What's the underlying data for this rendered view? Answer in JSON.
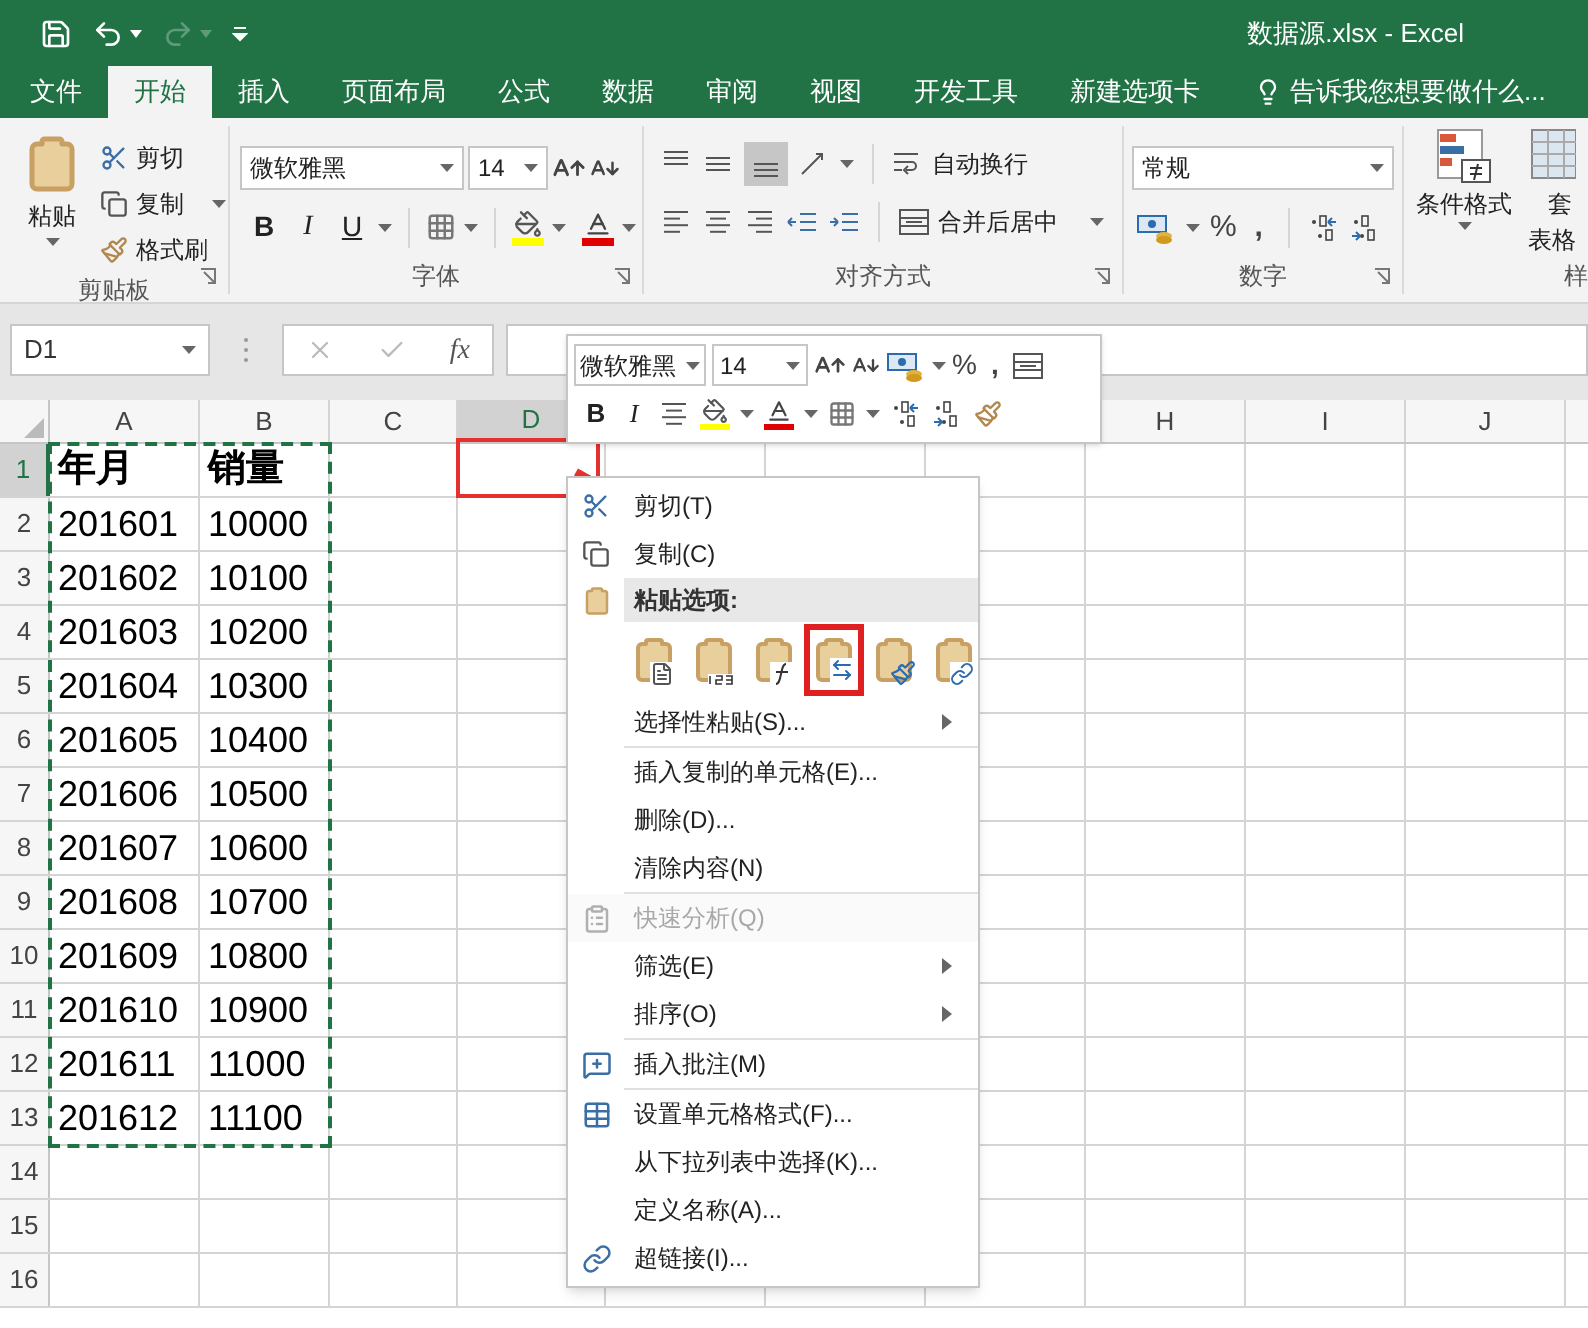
{
  "title_bar": {
    "title": "数据源.xlsx - Excel"
  },
  "ribbon_tabs": [
    {
      "label": "文件",
      "selected": false
    },
    {
      "label": "开始",
      "selected": true
    },
    {
      "label": "插入",
      "selected": false
    },
    {
      "label": "页面布局",
      "selected": false
    },
    {
      "label": "公式",
      "selected": false
    },
    {
      "label": "数据",
      "selected": false
    },
    {
      "label": "审阅",
      "selected": false
    },
    {
      "label": "视图",
      "selected": false
    },
    {
      "label": "开发工具",
      "selected": false
    },
    {
      "label": "新建选项卡",
      "selected": false
    }
  ],
  "tell_me": "告诉我您想要做什么...",
  "ribbon": {
    "clipboard": {
      "paste": "粘贴",
      "cut": "剪切",
      "copy": "复制",
      "format_painter": "格式刷",
      "label": "剪贴板"
    },
    "font": {
      "font_name": "微软雅黑",
      "font_size": "14",
      "bold": "B",
      "italic": "I",
      "underline": "U",
      "label": "字体"
    },
    "alignment": {
      "wrap_text": "自动换行",
      "merge_center": "合并后居中",
      "label": "对齐方式"
    },
    "number": {
      "format": "常规",
      "percent": "%",
      "comma": ",",
      "label": "数字"
    },
    "styles": {
      "conditional_formatting": "条件格式",
      "format_as_table_line1": "套",
      "format_as_table_line2": "表格",
      "label": "样"
    }
  },
  "formula_bar": {
    "name_box": "D1",
    "fx": "fx"
  },
  "sheet": {
    "marquee": true,
    "columns_left": [
      {
        "label": "A",
        "selected": false
      },
      {
        "label": "B",
        "selected": false
      },
      {
        "label": "C",
        "selected": false
      },
      {
        "label": "D",
        "selected": true
      }
    ],
    "columns_right": [
      {
        "label": "H",
        "selected": false
      },
      {
        "label": "I",
        "selected": false
      },
      {
        "label": "J",
        "selected": false
      }
    ],
    "rows": [
      {
        "label": "1",
        "selected": true,
        "kind": "header",
        "cells": [
          "年月",
          "销量"
        ]
      },
      {
        "label": "2",
        "selected": false,
        "kind": "data",
        "cells": [
          "201601",
          "10000"
        ]
      },
      {
        "label": "3",
        "selected": false,
        "kind": "data",
        "cells": [
          "201602",
          "10100"
        ]
      },
      {
        "label": "4",
        "selected": false,
        "kind": "data",
        "cells": [
          "201603",
          "10200"
        ]
      },
      {
        "label": "5",
        "selected": false,
        "kind": "data",
        "cells": [
          "201604",
          "10300"
        ]
      },
      {
        "label": "6",
        "selected": false,
        "kind": "data",
        "cells": [
          "201605",
          "10400"
        ]
      },
      {
        "label": "7",
        "selected": false,
        "kind": "data",
        "cells": [
          "201606",
          "10500"
        ]
      },
      {
        "label": "8",
        "selected": false,
        "kind": "data",
        "cells": [
          "201607",
          "10600"
        ]
      },
      {
        "label": "9",
        "selected": false,
        "kind": "data",
        "cells": [
          "201608",
          "10700"
        ]
      },
      {
        "label": "10",
        "selected": false,
        "kind": "data",
        "cells": [
          "201609",
          "10800"
        ]
      },
      {
        "label": "11",
        "selected": false,
        "kind": "data",
        "cells": [
          "201610",
          "10900"
        ]
      },
      {
        "label": "12",
        "selected": false,
        "kind": "data",
        "cells": [
          "201611",
          "11000"
        ]
      },
      {
        "label": "13",
        "selected": false,
        "kind": "data",
        "cells": [
          "201612",
          "11100"
        ]
      },
      {
        "label": "14",
        "selected": false,
        "kind": "empty"
      },
      {
        "label": "15",
        "selected": false,
        "kind": "empty"
      },
      {
        "label": "16",
        "selected": false,
        "kind": "empty"
      }
    ]
  },
  "mini_toolbar": {
    "font_name": "微软雅黑",
    "font_size": "14",
    "percent": "%",
    "comma": ",",
    "bold": "B",
    "italic": "I"
  },
  "context_menu": {
    "sections": [
      [
        {
          "kind": "command",
          "label": "剪切(T)",
          "disabled": false,
          "submenu": false
        },
        {
          "kind": "command",
          "label": "复制(C)",
          "disabled": false,
          "submenu": false
        },
        {
          "kind": "header",
          "label": "粘贴选项:"
        },
        {
          "kind": "paste_options",
          "options": [
            {
              "kind": "paste",
              "highlighted": false
            },
            {
              "kind": "values",
              "highlighted": false
            },
            {
              "kind": "formulas",
              "highlighted": false
            },
            {
              "kind": "transpose",
              "highlighted": true
            },
            {
              "kind": "formatting",
              "highlighted": false
            },
            {
              "kind": "link",
              "highlighted": false
            }
          ]
        },
        {
          "kind": "command",
          "label": "选择性粘贴(S)...",
          "disabled": false,
          "submenu": true
        }
      ],
      [
        {
          "kind": "command",
          "label": "插入复制的单元格(E)...",
          "disabled": false,
          "submenu": false
        },
        {
          "kind": "command",
          "label": "删除(D)...",
          "disabled": false,
          "submenu": false
        },
        {
          "kind": "command",
          "label": "清除内容(N)",
          "disabled": false,
          "submenu": false
        }
      ],
      [
        {
          "kind": "command",
          "label": "快速分析(Q)",
          "disabled": true,
          "submenu": false
        },
        {
          "kind": "command",
          "label": "筛选(E)",
          "disabled": false,
          "submenu": true
        },
        {
          "kind": "command",
          "label": "排序(O)",
          "disabled": false,
          "submenu": true
        }
      ],
      [
        {
          "kind": "command",
          "label": "插入批注(M)",
          "disabled": false,
          "submenu": false
        }
      ],
      [
        {
          "kind": "command",
          "label": "设置单元格格式(F)...",
          "disabled": false,
          "submenu": false
        },
        {
          "kind": "command",
          "label": "从下拉列表中选择(K)...",
          "disabled": false,
          "submenu": false
        },
        {
          "kind": "command",
          "label": "定义名称(A)...",
          "disabled": false,
          "submenu": false
        },
        {
          "kind": "command",
          "label": "超链接(I)...",
          "disabled": false,
          "submenu": false
        }
      ]
    ]
  }
}
